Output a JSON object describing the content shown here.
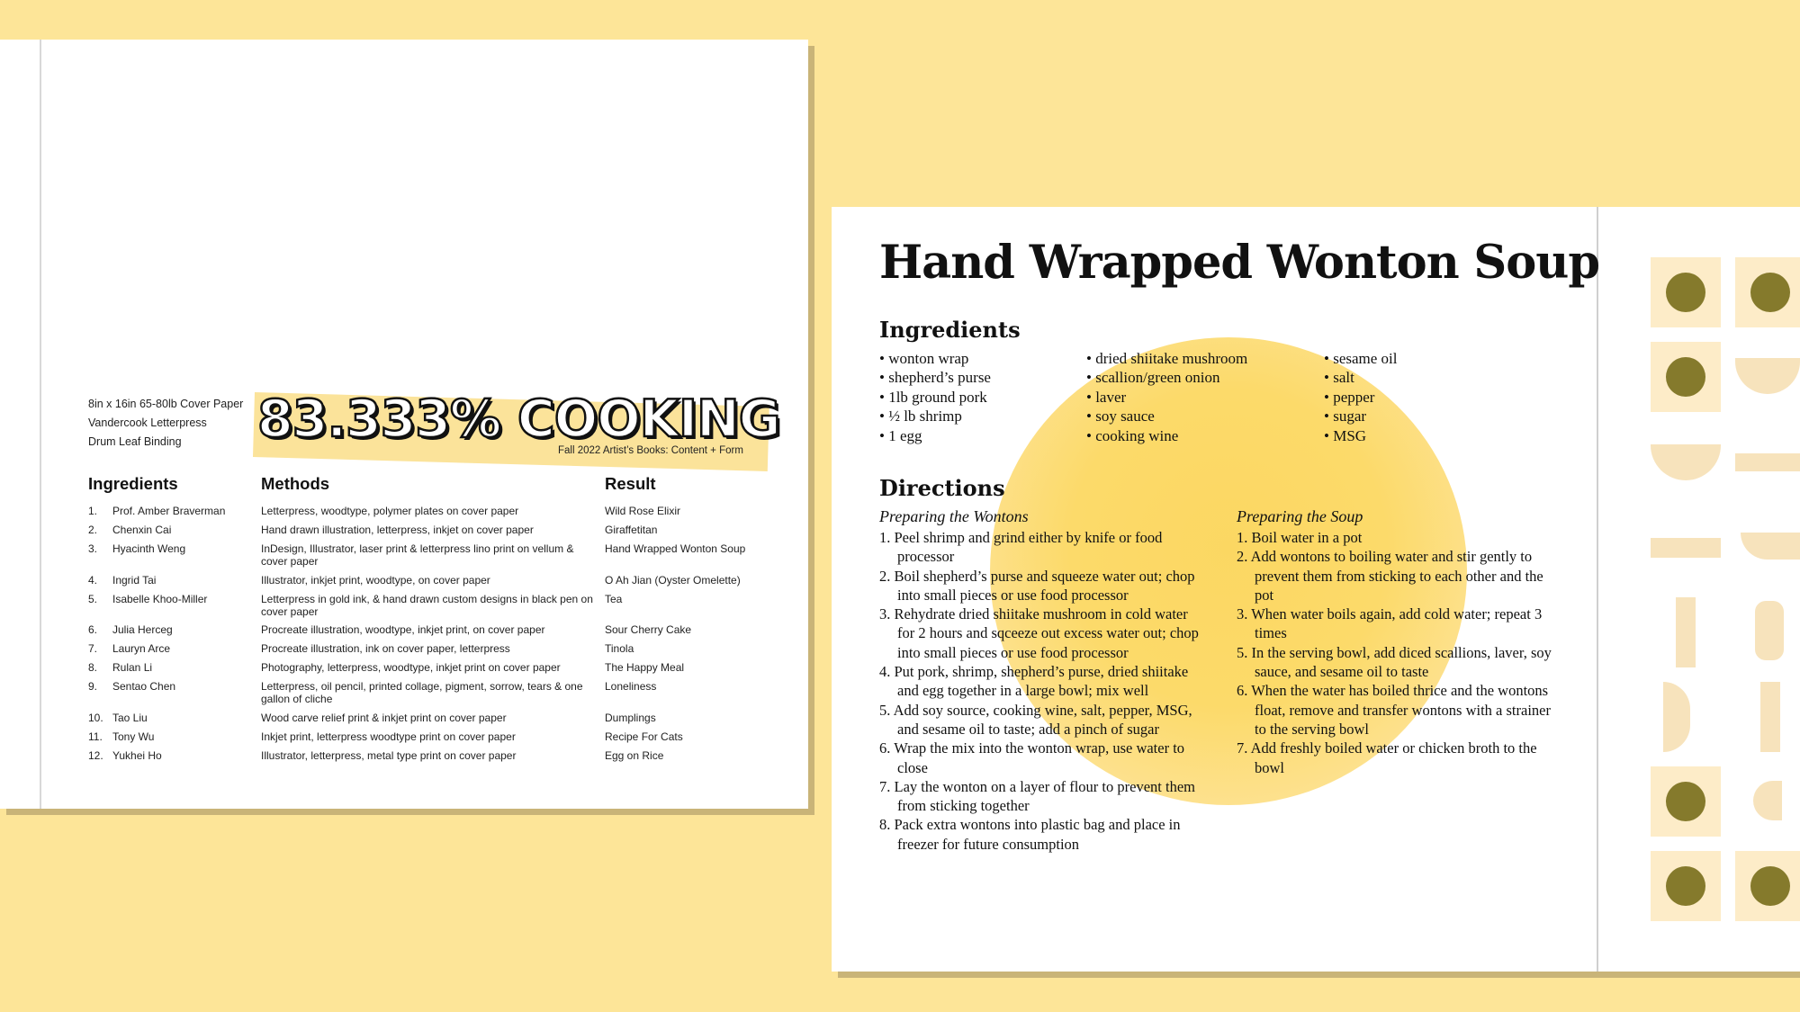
{
  "left_page": {
    "specs": [
      "8in x 16in 65-80lb Cover Paper",
      "Vandercook Letterpress",
      "Drum Leaf Binding"
    ],
    "title": "83.333% COOKING",
    "subtitle": "Fall 2022 Artist’s Books: Content + Form",
    "headers": {
      "ingredients": "Ingredients",
      "methods": "Methods",
      "result": "Result"
    },
    "rows": [
      {
        "num": "1.",
        "name": "Prof. Amber Braverman",
        "method": "Letterpress, woodtype, polymer plates on cover paper",
        "result": "Wild Rose Elixir"
      },
      {
        "num": "2.",
        "name": "Chenxin Cai",
        "method": "Hand drawn illustration, letterpress, inkjet on cover paper",
        "result": "Giraffetitan"
      },
      {
        "num": "3.",
        "name": "Hyacinth Weng",
        "method": "InDesign, Illustrator, laser print & letterpress lino print on vellum & cover paper",
        "result": "Hand Wrapped Wonton Soup"
      },
      {
        "num": "4.",
        "name": "Ingrid Tai",
        "method": "Illustrator, inkjet print, woodtype, on cover paper",
        "result": "O Ah Jian (Oyster Omelette)"
      },
      {
        "num": "5.",
        "name": "Isabelle Khoo-Miller",
        "method": "Letterpress in gold ink, & hand drawn custom designs in black pen on cover paper",
        "result": "Tea"
      },
      {
        "num": "6.",
        "name": "Julia Herceg",
        "method": "Procreate illustration, woodtype, inkjet print, on cover paper",
        "result": "Sour Cherry Cake"
      },
      {
        "num": "7.",
        "name": "Lauryn Arce",
        "method": "Procreate illustration, ink on cover paper, letterpress",
        "result": "Tinola"
      },
      {
        "num": "8.",
        "name": "Rulan Li",
        "method": "Photography, letterpress, woodtype, inkjet print on cover paper",
        "result": "The Happy Meal"
      },
      {
        "num": "9.",
        "name": "Sentao Chen",
        "method": "Letterpress, oil pencil, printed collage, pigment, sorrow, tears & one gallon of cliche",
        "result": "Loneliness"
      },
      {
        "num": "10.",
        "name": "Tao Liu",
        "method": "Wood carve relief print & inkjet print on cover paper",
        "result": "Dumplings"
      },
      {
        "num": "11.",
        "name": "Tony Wu",
        "method": "Inkjet print, letterpress woodtype print on cover paper",
        "result": "Recipe For Cats"
      },
      {
        "num": "12.",
        "name": "Yukhei Ho",
        "method": "Illustrator, letterpress, metal type print on cover paper",
        "result": "Egg on Rice"
      }
    ]
  },
  "right_page": {
    "title": "Hand Wrapped Wonton Soup",
    "ingredients_heading": "Ingredients",
    "ingredients": [
      [
        "wonton wrap",
        "shepherd’s purse",
        "1lb ground pork",
        "½ lb shrimp",
        "1 egg"
      ],
      [
        "dried shiitake mushroom",
        "scallion/green onion",
        "laver",
        "soy sauce",
        "cooking wine"
      ],
      [
        "sesame oil",
        "salt",
        "pepper",
        "sugar",
        "MSG"
      ]
    ],
    "directions_heading": "Directions",
    "wontons_heading": "Preparing the Wontons",
    "wontons_steps": [
      "1. Peel shrimp and grind either by knife or food processor",
      "2. Boil shepherd’s purse and squeeze water out; chop into small pieces or use food processor",
      "3. Rehydrate dried shiitake mushroom in cold water for 2 hours and sqceeze out excess water out; chop into small pieces or use food processor",
      "4. Put pork, shrimp, shepherd’s purse, dried shiitake and egg together in a large bowl; mix well",
      "5. Add soy source, cooking wine, salt, pepper, MSG, and sesame oil to taste; add a pinch of sugar",
      "6. Wrap the mix into the wonton wrap, use water to close",
      "7. Lay the wonton on a layer of flour to prevent them from sticking together",
      "8. Pack extra wontons into plastic bag and place in freezer for future consumption"
    ],
    "soup_heading": "Preparing the Soup",
    "soup_steps": [
      "1. Boil water in a pot",
      "2. Add wontons to boiling water and stir gently to prevent them from sticking to each other and the pot",
      "3. When water boils again, add cold water; repeat 3 times",
      "5. In the serving bowl, add diced scallions, laver, soy sauce, and sesame oil to taste",
      "6. When the water has boiled thrice and the wontons float, remove and transfer wontons with a strainer to the serving bowl",
      "7. Add freshly boiled water or chicken broth to the bowl"
    ]
  },
  "colors": {
    "background": "#fde598",
    "dot": "#857a2c",
    "blob": "#fcd862",
    "tile": "#fdecc8"
  }
}
